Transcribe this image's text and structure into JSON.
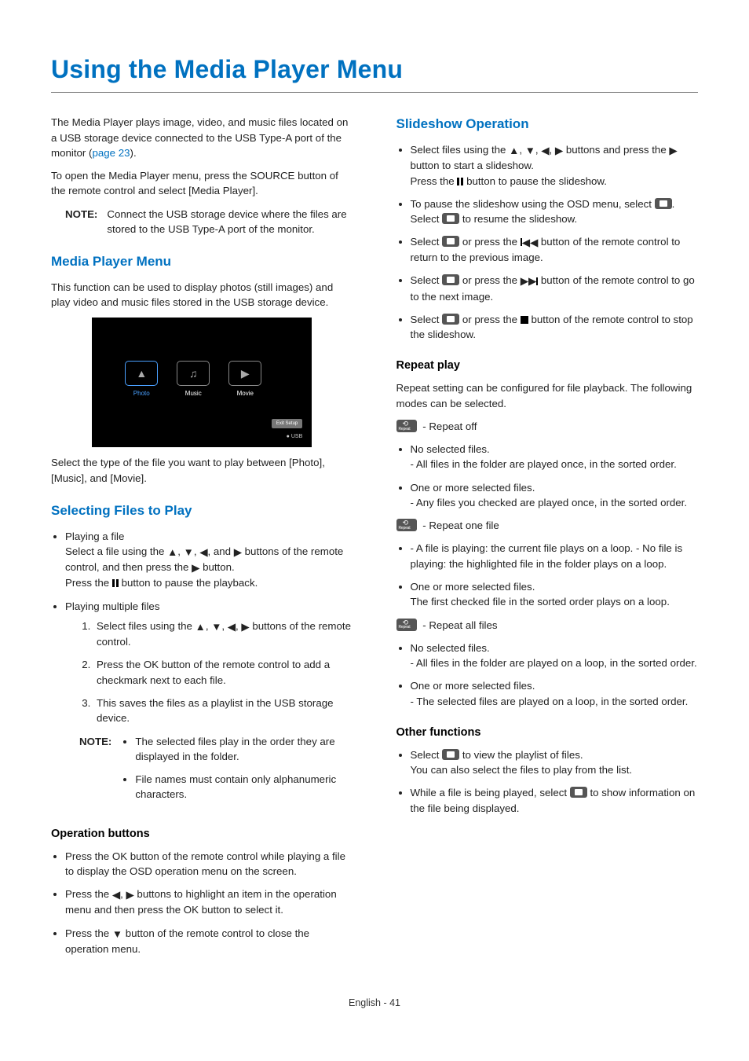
{
  "page": {
    "title": "Using the Media Player Menu",
    "footer": "English - 41"
  },
  "intro": {
    "p1a": "The Media Player plays image, video, and music files located on a USB storage device connected to the USB Type-A port of the monitor (",
    "link": "page 23",
    "p1b": ").",
    "p2": "To open the Media Player menu, press the SOURCE button of the remote control and select [Media Player].",
    "note_label": "NOTE:",
    "note": "Connect the USB storage device where the files are stored to the USB Type-A port of the monitor."
  },
  "mpm": {
    "heading": "Media Player Menu",
    "p1": "This function can be used to display photos (still images) and play video and music files stored in the USB storage device.",
    "p2": "Select the type of the file you want to play between [Photo], [Music], and [Movie].",
    "shot": {
      "photo": "Photo",
      "music": "Music",
      "movie": "Movie",
      "btn": "Exit Setup",
      "usb": "USB"
    }
  },
  "sel": {
    "heading": "Selecting Files to Play",
    "b1_title": "Playing a file",
    "b1_l1a": "Select a file using the ",
    "b1_l1b": " buttons of the remote control, and then press the ",
    "b1_l1c": " button.",
    "b1_l2a": "Press the ",
    "b1_l2b": " button to pause the playback.",
    "b2_title": "Playing multiple files",
    "b2_o1a": "Select files using the ",
    "b2_o1b": " buttons of the remote control.",
    "b2_o2": "Press the OK button of the remote control to add a checkmark next to each file.",
    "b2_o3": "This saves the files as a playlist in the USB storage device.",
    "note_label": "NOTE:",
    "note_b1": "The selected files play in the order they are displayed in the folder.",
    "note_b2": "File names must contain only alphanumeric characters."
  },
  "opb": {
    "heading": "Operation buttons",
    "b1": "Press the OK button of the remote control while playing a file to display the OSD operation menu on the screen.",
    "b2a": "Press the ",
    "b2b": " buttons to highlight an item in the operation menu and then press the OK button to select it.",
    "b3a": "Press the ",
    "b3b": " button of the remote control to close the operation menu."
  },
  "slide": {
    "heading": "Slideshow Operation",
    "b1a": "Select files using the ",
    "b1b": " buttons and press the ",
    "b1c": " button to start a slideshow.",
    "b1d": "Press the ",
    "b1e": " button to pause the slideshow.",
    "b2a": "To pause the slideshow using the OSD menu, select ",
    "b2b": ".",
    "b2c": "Select ",
    "b2d": " to resume the slideshow.",
    "b3a": "Select ",
    "b3b": " or press the ",
    "b3c": " button of the remote control to return to the previous image.",
    "b4a": "Select ",
    "b4b": " or press the ",
    "b4c": " button of the remote control to go to the next image.",
    "b5a": "Select ",
    "b5b": " or press the ",
    "b5c": " button of the remote control to stop the slideshow."
  },
  "rep": {
    "heading": "Repeat play",
    "intro": "Repeat setting can be configured for file playback. The following modes can be selected.",
    "m1": " - Repeat off",
    "m1_b1": "No selected files.",
    "m1_b1s": "- All files in the folder are played once, in the sorted order.",
    "m1_b2": "One or more selected files.",
    "m1_b2s": "- Any files you checked are played once, in the sorted order.",
    "m2": " - Repeat one file",
    "m2_b1": "- A file is playing: the current file plays on a loop. - No file is playing: the highlighted file in the folder plays on a loop.",
    "m2_b2": "One or more selected files.",
    "m2_b2s": "The first checked file in the sorted order plays on a loop.",
    "m3": " - Repeat all files",
    "m3_b1": "No selected files.",
    "m3_b1s": "- All files in the folder are played on a loop, in the sorted order.",
    "m3_b2": "One or more selected files.",
    "m3_b2s": "- The selected files are played on a loop, in the sorted order."
  },
  "other": {
    "heading": "Other functions",
    "b1a": "Select ",
    "b1b": " to view the playlist of files.",
    "b1c": "You can also select the files to play from the list.",
    "b2a": "While a file is being played, select ",
    "b2b": " to show information on the file being displayed."
  }
}
